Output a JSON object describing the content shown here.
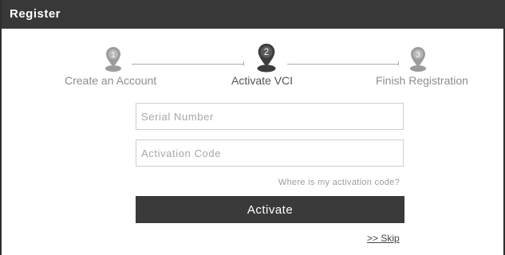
{
  "window": {
    "title": "Register"
  },
  "steps": [
    {
      "number": "1",
      "label": "Create an Account",
      "state": "inactive"
    },
    {
      "number": "2",
      "label": "Activate VCI",
      "state": "active"
    },
    {
      "number": "3",
      "label": "Finish Registration",
      "state": "inactive"
    }
  ],
  "form": {
    "serial_placeholder": "Serial Number",
    "activation_placeholder": "Activation Code",
    "help_link": "Where is my activation code?",
    "activate_label": "Activate",
    "skip_label": ">> Skip"
  },
  "colors": {
    "titlebar": "#383838",
    "step_inactive": "#9b9b9b",
    "step_active": "#3c3c3c",
    "button": "#3a3a3a"
  }
}
